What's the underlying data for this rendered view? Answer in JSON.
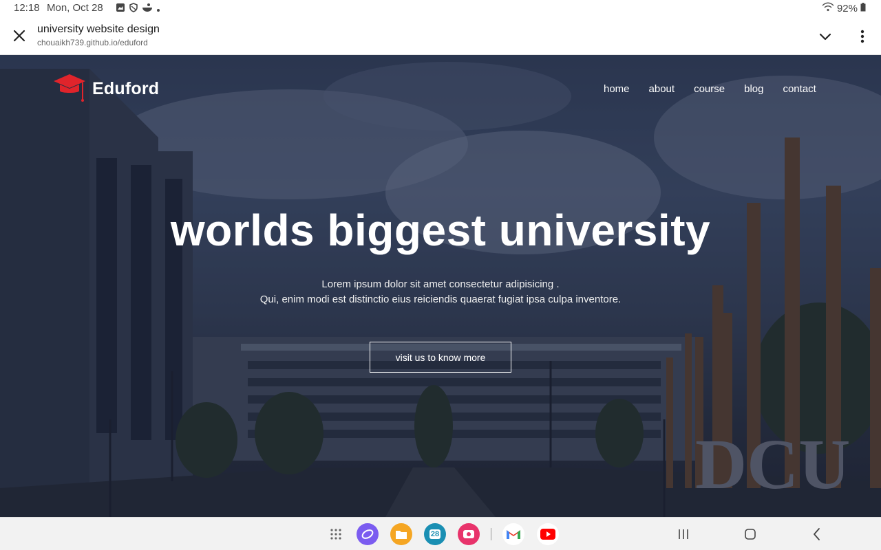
{
  "status_bar": {
    "time": "12:18",
    "date": "Mon, Oct 28",
    "battery": "92%"
  },
  "tab_header": {
    "title": "university website design",
    "url": "chouaikh739.github.io/eduford"
  },
  "site": {
    "brand": "Eduford",
    "nav": [
      "home",
      "about",
      "course",
      "blog",
      "contact"
    ],
    "headline": "worlds biggest university",
    "sub_line_1": "Lorem ipsum dolor sit amet consectetur adipisicing .",
    "sub_line_2": "Qui, enim modi est distinctio eius reiciendis quaerat fugiat ipsa culpa inventore.",
    "cta": "visit us to know more",
    "sign_text": "DCU"
  },
  "taskbar": {
    "calendar_day": "28"
  },
  "colors": {
    "logo_red": "#e0242b",
    "overlay": "#121a30"
  }
}
